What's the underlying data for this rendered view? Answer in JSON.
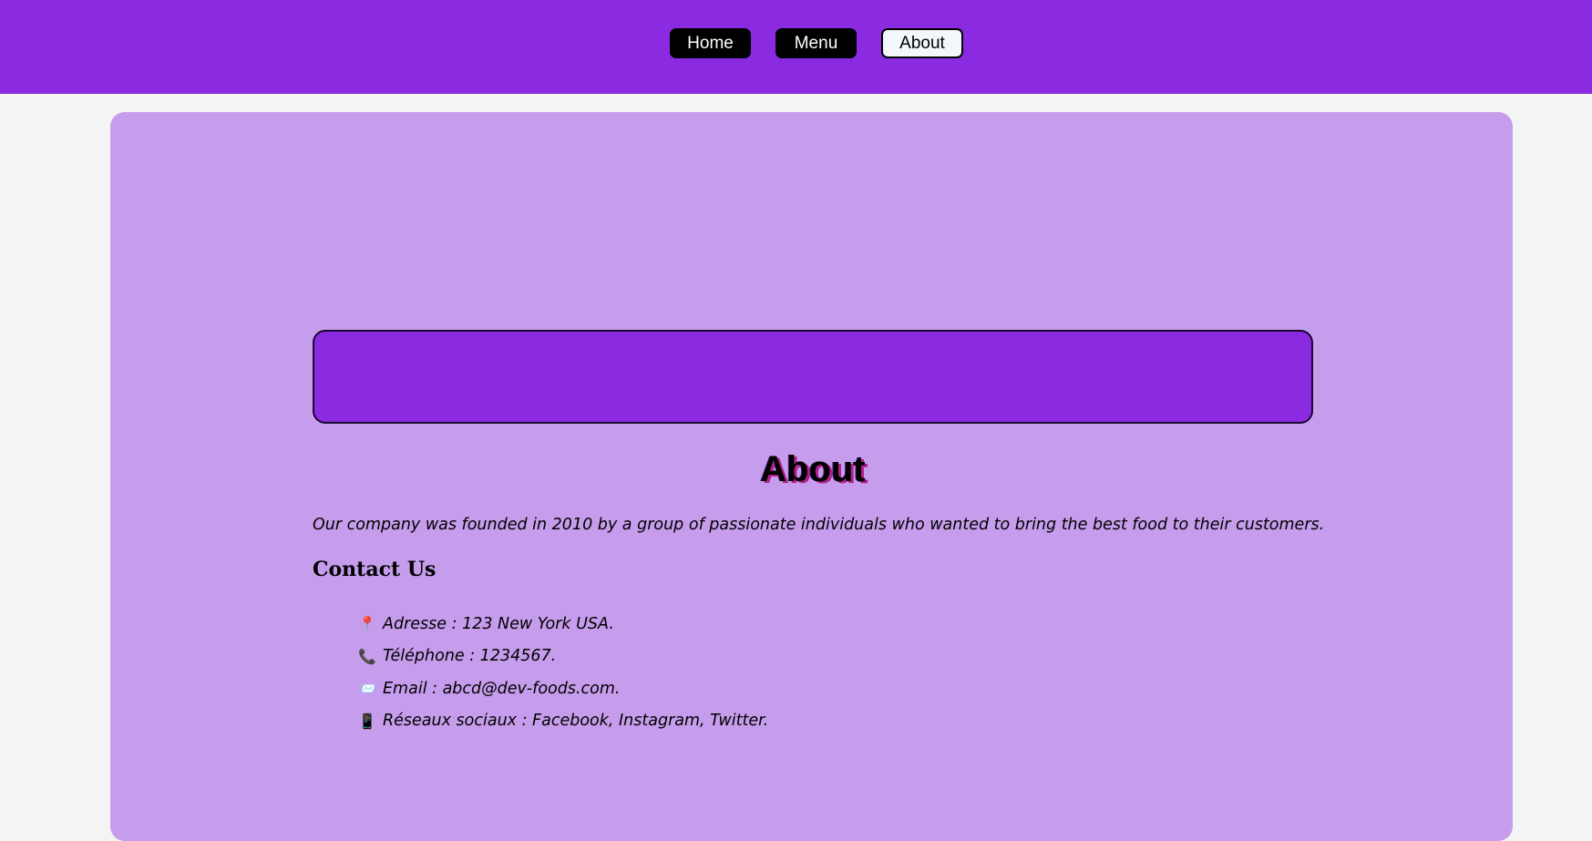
{
  "nav": {
    "home_label": "Home",
    "menu_label": "Menu",
    "about_label": "About"
  },
  "page": {
    "title": "About",
    "intro": "Our company was founded in 2010 by a group of passionate individuals who wanted to bring the best food to their customers."
  },
  "contact": {
    "heading": "Contact Us",
    "items": [
      {
        "icon": "pushpin-icon",
        "glyph": "📍",
        "text": "Adresse : 123 New York USA."
      },
      {
        "icon": "telephone-icon",
        "glyph": "📞",
        "text": "Téléphone : 1234567."
      },
      {
        "icon": "envelope-icon",
        "glyph": "📨",
        "text": "Email : abcd@dev-foods.com."
      },
      {
        "icon": "mobile-phone-icon",
        "glyph": "📱",
        "text": "Réseaux sociaux : Facebook, Instagram, Twitter."
      }
    ]
  },
  "colors": {
    "brand_purple": "#8a2be2",
    "panel_lavender": "#c69dec",
    "page_background": "#f4f4f4",
    "title_shadow": "#b0208a"
  }
}
